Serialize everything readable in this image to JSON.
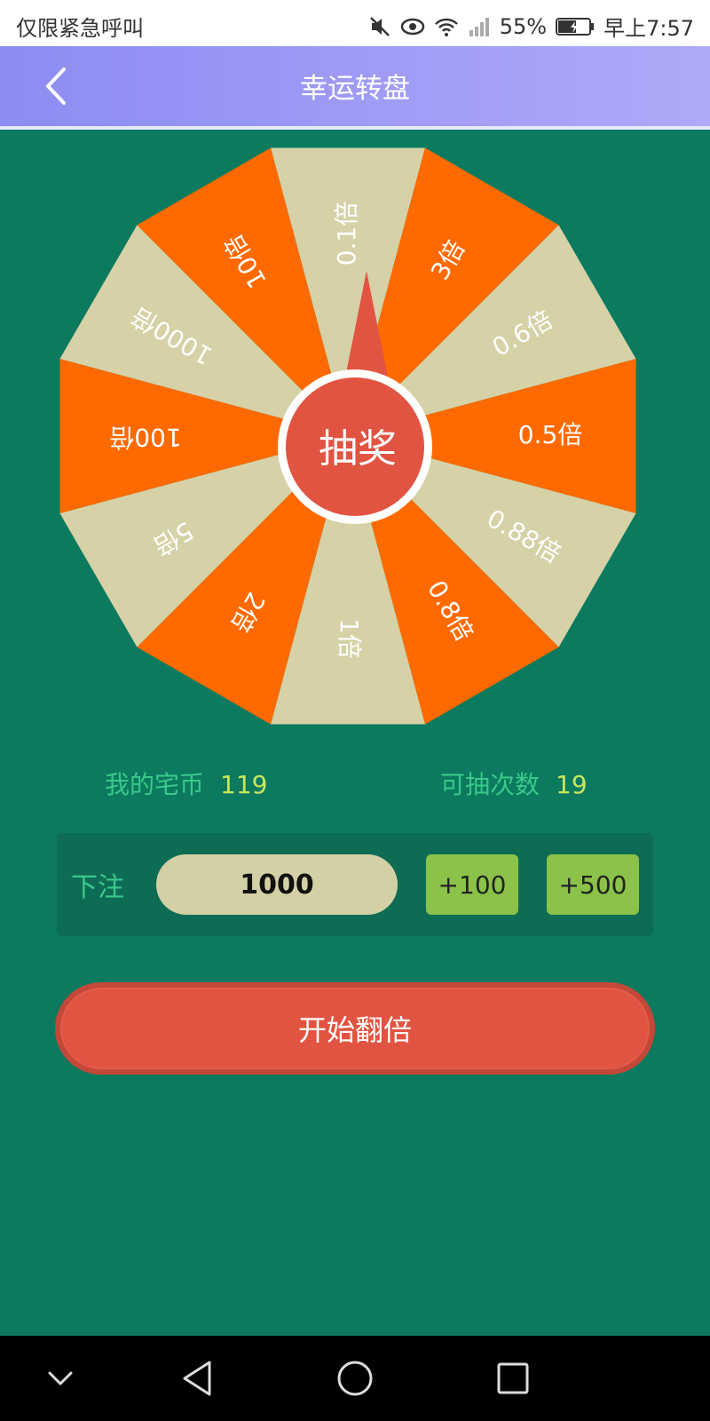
{
  "status_bar": {
    "carrier": "仅限紧急呼叫",
    "battery": "55%",
    "time": "早上7:57"
  },
  "header": {
    "title": "幸运转盘",
    "back_icon": "chevron-left-icon"
  },
  "wheel": {
    "center_label": "抽奖",
    "segments": [
      "0.1倍",
      "3倍",
      "0.6倍",
      "0.5倍",
      "0.88倍",
      "0.8倍",
      "1倍",
      "2倍",
      "5倍",
      "100倍",
      "1000倍",
      "10倍"
    ],
    "colors": {
      "orange": "#ff6a00",
      "beige": "#d6d1a6",
      "pointer": "#e15441"
    }
  },
  "stats": {
    "coins_label": "我的宅币",
    "coins_value": "119",
    "draws_label": "可抽次数",
    "draws_value": "19"
  },
  "bet": {
    "label": "下注",
    "amount": "1000",
    "add_100": "+100",
    "add_500": "+500"
  },
  "start_button": "开始翻倍"
}
